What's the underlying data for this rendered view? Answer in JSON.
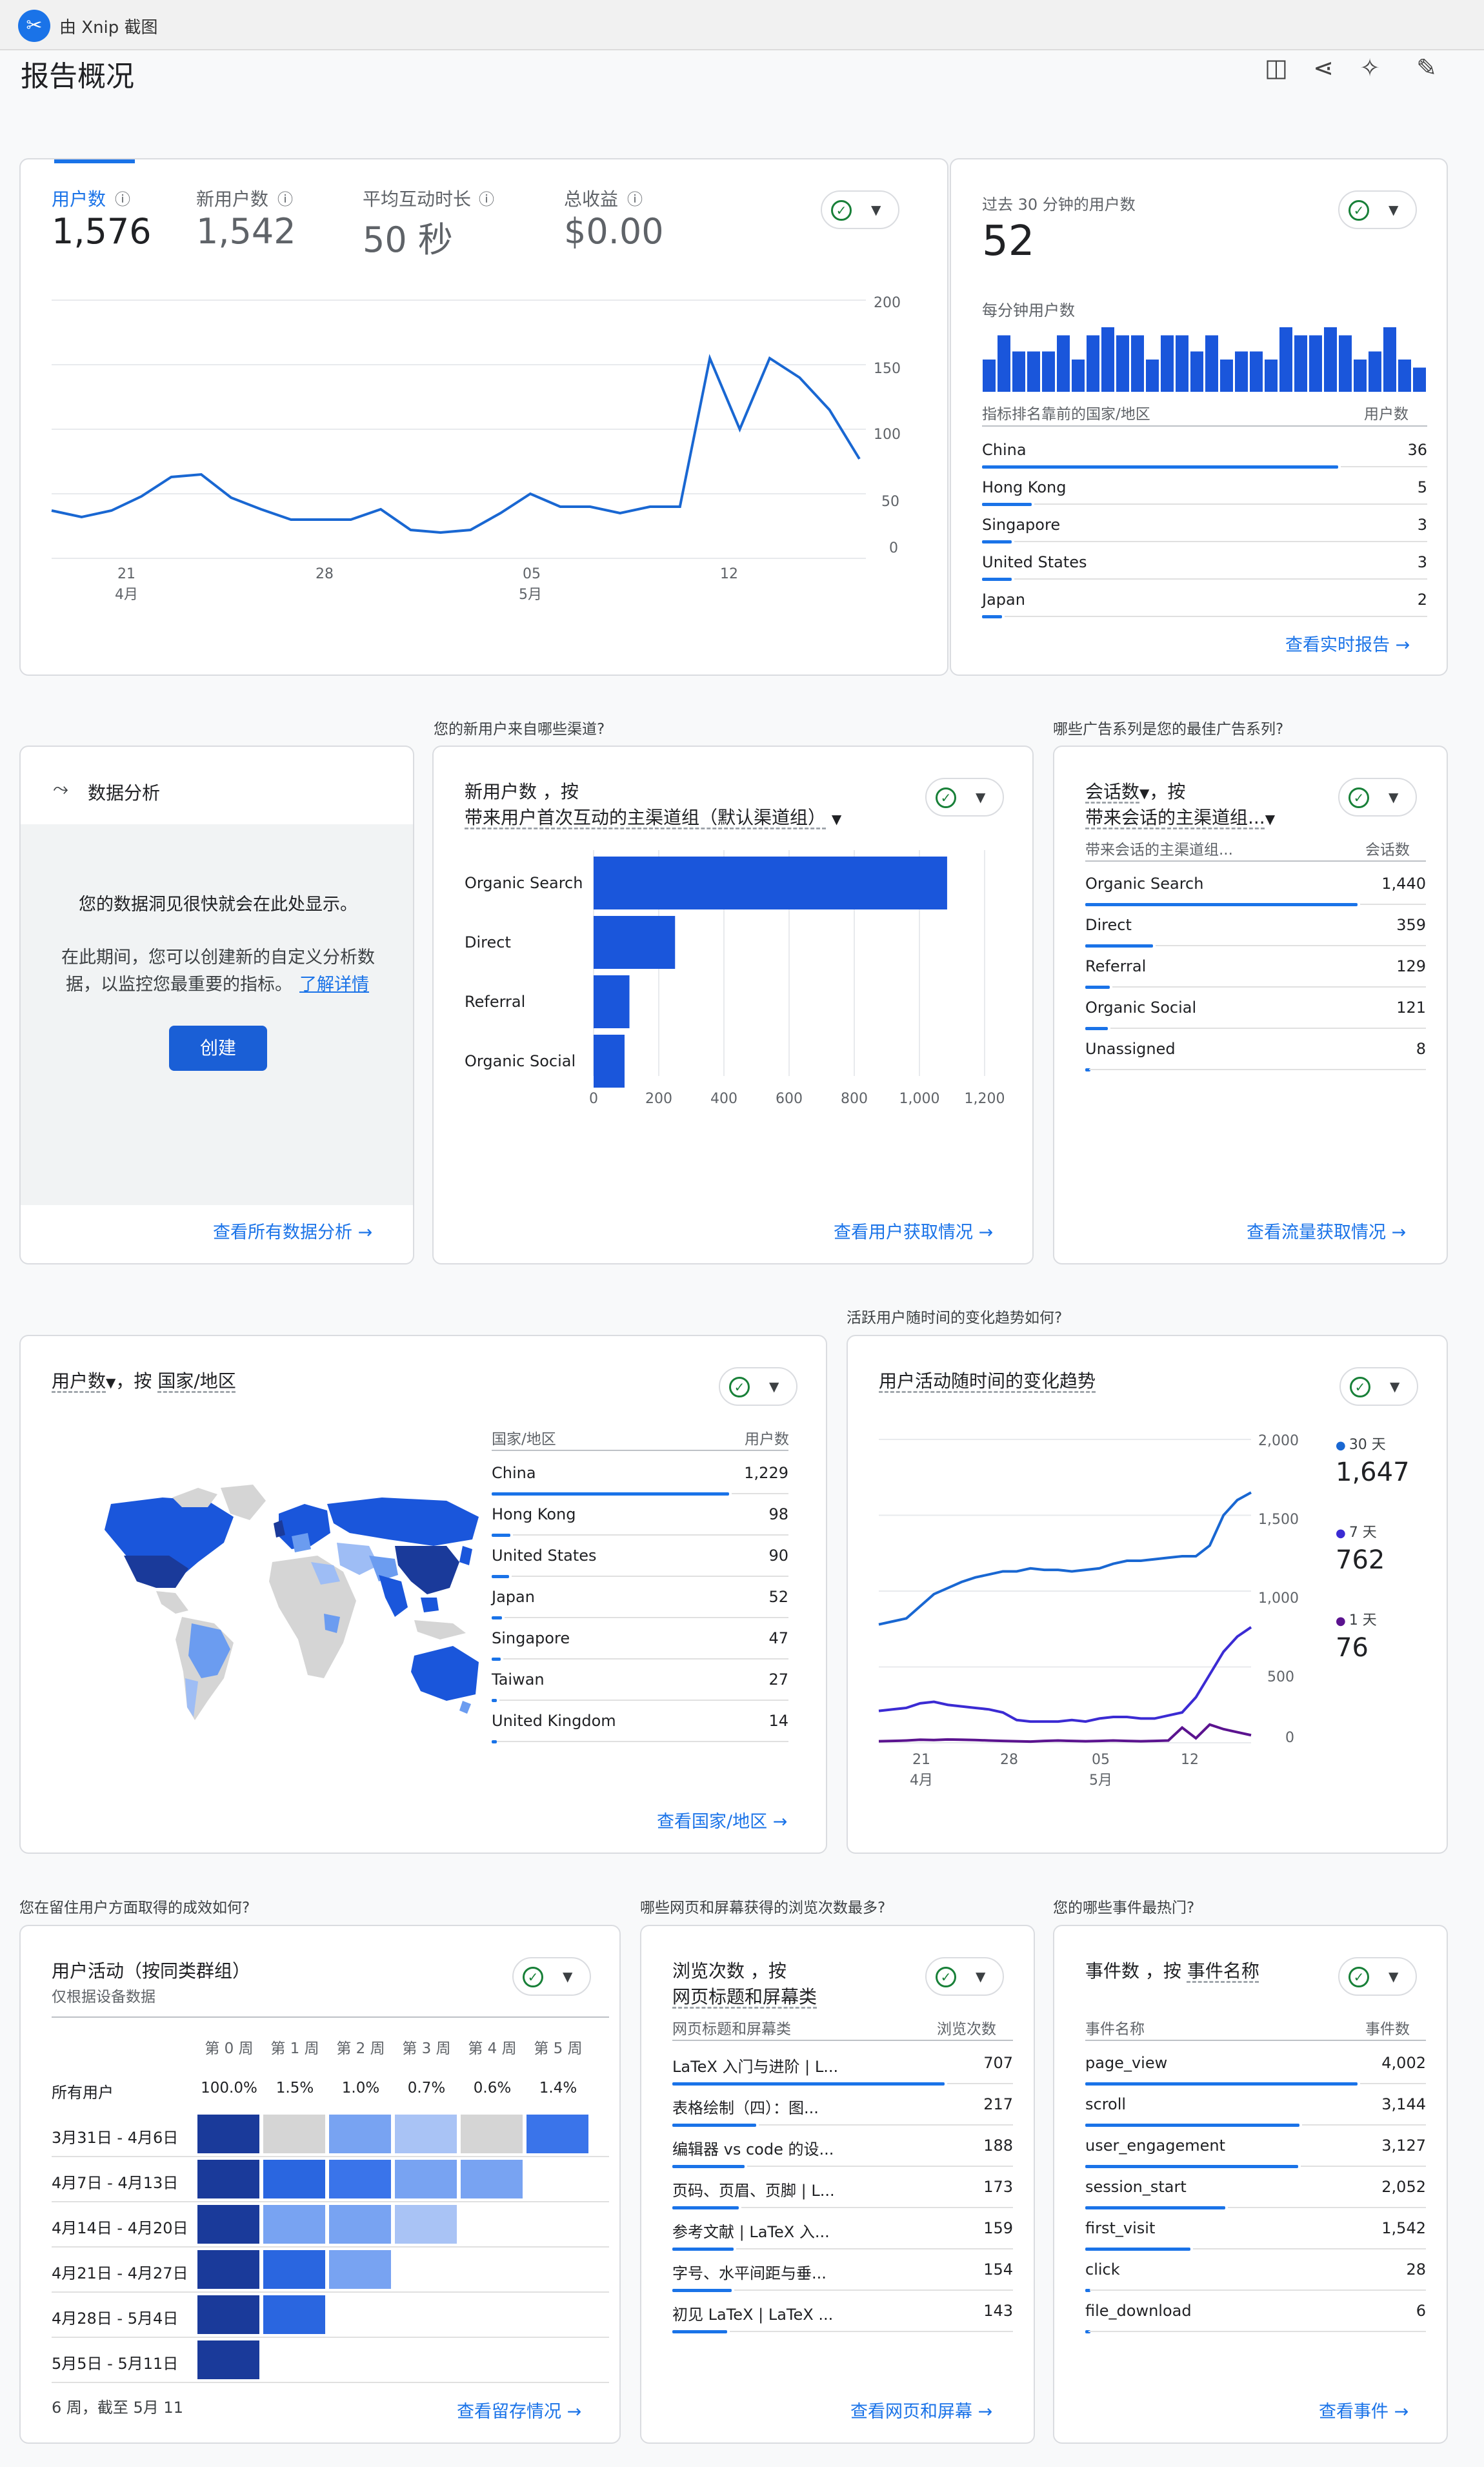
{
  "app": {
    "title_bar": "由 Xnip 截图",
    "page_title": "报告概况"
  },
  "overview": {
    "metrics": [
      {
        "label": "用户数",
        "value": "1,576"
      },
      {
        "label": "新用户数",
        "value": "1,542"
      },
      {
        "label": "平均互动时长",
        "value": "50 秒"
      },
      {
        "label": "总收益",
        "value": "$0.00"
      }
    ],
    "y_ticks": [
      "200",
      "150",
      "100",
      "50",
      "0"
    ],
    "x_ticks": [
      {
        "d": "21",
        "m": "4月"
      },
      {
        "d": "28",
        "m": ""
      },
      {
        "d": "05",
        "m": "5月"
      },
      {
        "d": "12",
        "m": ""
      }
    ]
  },
  "realtime": {
    "title": "过去 30 分钟的用户数",
    "value": "52",
    "sub": "每分钟用户数",
    "col1": "指标排名靠前的国家/地区",
    "col2": "用户数",
    "rows": [
      {
        "name": "China",
        "value": "36"
      },
      {
        "name": "Hong Kong",
        "value": "5"
      },
      {
        "name": "Singapore",
        "value": "3"
      },
      {
        "name": "United States",
        "value": "3"
      },
      {
        "name": "Japan",
        "value": "2"
      }
    ],
    "link": "查看实时报告"
  },
  "section_q": {
    "channels": "您的新用户来自哪些渠道?",
    "campaigns": "哪些广告系列是您的最佳广告系列?",
    "trend": "活跃用户随时间的变化趋势如何?",
    "retention": "您在留住用户方面取得的成效如何?",
    "pages": "哪些网页和屏幕获得的浏览次数最多?",
    "events": "您的哪些事件最热门?"
  },
  "insights": {
    "title": "数据分析",
    "text1": "您的数据洞见很快就会在此处显示。",
    "text2a": "在此期间，您可以创建新的自定义分析数",
    "text2b": "据，以监控您最重要的指标。",
    "learn": "了解详情",
    "create": "创建",
    "link": "查看所有数据分析"
  },
  "new_users": {
    "title1": "新用户数 ，按",
    "title2": "带来用户首次互动的主渠道组（默认渠道组）",
    "x_ticks": [
      "0",
      "200",
      "400",
      "600",
      "800",
      "1,000",
      "1,200"
    ],
    "link": "查看用户获取情况"
  },
  "sessions": {
    "title1": "会话数",
    "title1b": "，按",
    "title2": "带来会话的主渠道组...",
    "col1": "带来会话的主渠道组...",
    "col2": "会话数",
    "rows": [
      {
        "name": "Organic Search",
        "value": "1,440"
      },
      {
        "name": "Direct",
        "value": "359"
      },
      {
        "name": "Referral",
        "value": "129"
      },
      {
        "name": "Organic Social",
        "value": "121"
      },
      {
        "name": "Unassigned",
        "value": "8"
      }
    ],
    "link": "查看流量获取情况"
  },
  "country": {
    "title1": "用户数",
    "title1b": "，按",
    "title2": "国家/地区",
    "col1": "国家/地区",
    "col2": "用户数",
    "rows": [
      {
        "name": "China",
        "value": "1,229"
      },
      {
        "name": "Hong Kong",
        "value": "98"
      },
      {
        "name": "United States",
        "value": "90"
      },
      {
        "name": "Japan",
        "value": "52"
      },
      {
        "name": "Singapore",
        "value": "47"
      },
      {
        "name": "Taiwan",
        "value": "27"
      },
      {
        "name": "United Kingdom",
        "value": "14"
      }
    ],
    "link": "查看国家/地区"
  },
  "activity": {
    "title": "用户活动随时间的变化趋势",
    "y_ticks": [
      "2,000",
      "1,500",
      "1,000",
      "500",
      "0"
    ],
    "x_ticks": [
      {
        "d": "21",
        "m": "4月"
      },
      {
        "d": "28",
        "m": ""
      },
      {
        "d": "05",
        "m": "5月"
      },
      {
        "d": "12",
        "m": ""
      }
    ],
    "legend": [
      {
        "label": "30 天",
        "value": "1,647",
        "color": "#1967d2"
      },
      {
        "label": "7 天",
        "value": "762",
        "color": "#3b2bd3"
      },
      {
        "label": "1 天",
        "value": "76",
        "color": "#5b138f"
      }
    ]
  },
  "retention": {
    "title": "用户活动（按同类群组）",
    "subtitle": "仅根据设备数据",
    "weeks": [
      "第 0 周",
      "第 1 周",
      "第 2 周",
      "第 3 周",
      "第 4 周",
      "第 5 周"
    ],
    "all_label": "所有用户",
    "all_values": [
      "100.0%",
      "1.5%",
      "1.0%",
      "0.7%",
      "0.6%",
      "1.4%"
    ],
    "cohorts": [
      "3月31日 - 4月6日",
      "4月7日 - 4月13日",
      "4月14日 - 4月20日",
      "4月21日 - 4月27日",
      "4月28日 - 5月4日",
      "5月5日 - 5月11日"
    ],
    "footer": "6 周，截至 5月 11",
    "link": "查看留存情况"
  },
  "pages": {
    "title1": "浏览次数 ，按",
    "title2": "网页标题和屏幕类",
    "col1": "网页标题和屏幕类",
    "col2": "浏览次数",
    "rows": [
      {
        "name": "LaTeX 入门与进阶 | L...",
        "value": "707"
      },
      {
        "name": "表格绘制（四）：图...",
        "value": "217"
      },
      {
        "name": "编辑器 vs code 的设...",
        "value": "188"
      },
      {
        "name": "页码、页眉、页脚 | L...",
        "value": "173"
      },
      {
        "name": "参考文献 | LaTeX 入...",
        "value": "159"
      },
      {
        "name": "字号、水平间距与垂...",
        "value": "154"
      },
      {
        "name": "初见 LaTeX | LaTeX ...",
        "value": "143"
      }
    ],
    "link": "查看网页和屏幕"
  },
  "events": {
    "title1": "事件数 ，按",
    "title2": "事件名称",
    "col1": "事件名称",
    "col2": "事件数",
    "rows": [
      {
        "name": "page_view",
        "value": "4,002"
      },
      {
        "name": "scroll",
        "value": "3,144"
      },
      {
        "name": "user_engagement",
        "value": "3,127"
      },
      {
        "name": "session_start",
        "value": "2,052"
      },
      {
        "name": "first_visit",
        "value": "1,542"
      },
      {
        "name": "click",
        "value": "28"
      },
      {
        "name": "file_download",
        "value": "6"
      }
    ],
    "link": "查看事件"
  },
  "chart_data": [
    {
      "type": "line",
      "x": [
        "4月17",
        "4月18",
        "4月19",
        "4月20",
        "4月21",
        "4月22",
        "4月23",
        "4月24",
        "4月25",
        "4月26",
        "4月27",
        "4月28",
        "4月29",
        "4月30",
        "5月1",
        "5月2",
        "5月3",
        "5月4",
        "5月5",
        "5月6",
        "5月7",
        "5月8",
        "5月9",
        "5月10",
        "5月11",
        "5月12",
        "5月13",
        "5月14",
        "5月15",
        "5月16"
      ],
      "series": [
        {
          "values": [
            37,
            32,
            37,
            48,
            63,
            65,
            47,
            38,
            30,
            30,
            30,
            38,
            22,
            20,
            22,
            35,
            50,
            40,
            40,
            35,
            40,
            40,
            155,
            100,
            155,
            140,
            115,
            77
          ]
        }
      ],
      "ylim": [
        0,
        200
      ]
    },
    {
      "type": "bar",
      "values": [
        4,
        7,
        5,
        5,
        5,
        7,
        4,
        7,
        8,
        7,
        7,
        4,
        7,
        7,
        5,
        7,
        4,
        5,
        5,
        4,
        8,
        7,
        7,
        8,
        7,
        4,
        5,
        8,
        4,
        3
      ]
    },
    {
      "type": "bar",
      "categories": [
        "Organic Search",
        "Direct",
        "Referral",
        "Organic Social"
      ],
      "values": [
        1085,
        250,
        110,
        95
      ],
      "xlim": [
        0,
        1200
      ]
    },
    {
      "type": "line",
      "series": [
        {
          "name": "30 天",
          "values": [
            780,
            800,
            820,
            900,
            980,
            1020,
            1060,
            1090,
            1110,
            1130,
            1130,
            1150,
            1140,
            1140,
            1130,
            1140,
            1150,
            1180,
            1200,
            1200,
            1210,
            1220,
            1230,
            1230,
            1300,
            1500,
            1600,
            1650
          ]
        },
        {
          "name": "7 天",
          "values": [
            210,
            220,
            230,
            260,
            270,
            250,
            240,
            230,
            220,
            200,
            150,
            140,
            140,
            140,
            150,
            140,
            160,
            170,
            170,
            160,
            160,
            180,
            200,
            300,
            450,
            600,
            700,
            762
          ]
        },
        {
          "name": "1 天",
          "values": [
            10,
            12,
            15,
            20,
            18,
            22,
            20,
            18,
            15,
            12,
            10,
            8,
            12,
            15,
            12,
            10,
            12,
            15,
            12,
            10,
            12,
            15,
            100,
            30,
            120,
            90,
            70,
            50
          ]
        }
      ],
      "ylim": [
        0,
        2000
      ]
    },
    {
      "type": "heatmap",
      "rows": [
        "3月31日 - 4月6日",
        "4月7日 - 4月13日",
        "4月14日 - 4月20日",
        "4月21日 - 4月27日",
        "4月28日 - 5月4日",
        "5月5日 - 5月11日"
      ],
      "columns": [
        "第 0 周",
        "第 1 周",
        "第 2 周",
        "第 3 周",
        "第 4 周",
        "第 5 周"
      ],
      "values": [
        [
          100,
          0.2,
          1.0,
          0.7,
          0.2,
          1.4
        ],
        [
          100,
          1.8,
          1.5,
          0.8,
          1.0,
          null
        ],
        [
          100,
          0.8,
          0.8,
          0.7,
          null,
          null
        ],
        [
          100,
          1.6,
          1.0,
          null,
          null,
          null
        ],
        [
          100,
          2.1,
          null,
          null,
          null,
          null
        ],
        [
          100,
          null,
          null,
          null,
          null,
          null
        ]
      ]
    }
  ],
  "colors": {
    "accent": "#1a73e8",
    "dark_blue": "#1a3a9a",
    "success": "#188038"
  }
}
